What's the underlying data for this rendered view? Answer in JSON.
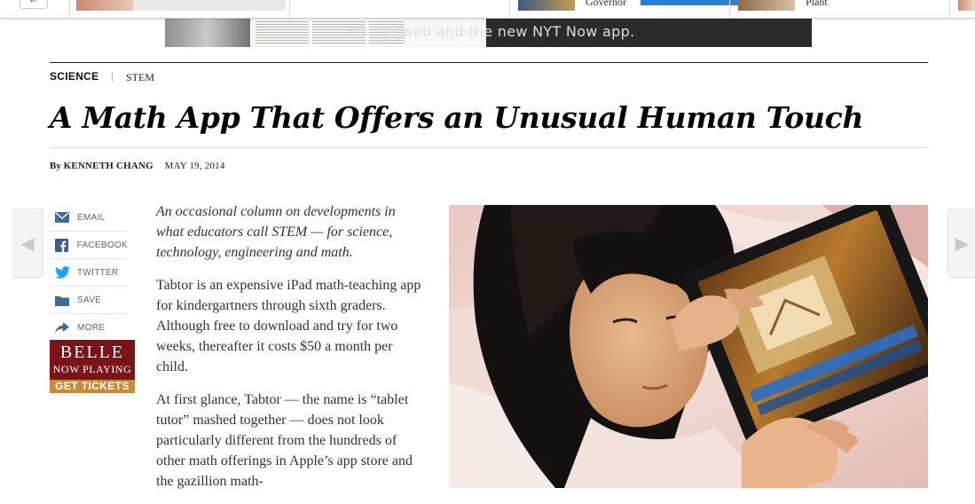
{
  "top_strip": {
    "back_label": "←",
    "items": [
      {
        "title": "Governor"
      },
      {
        "title": "Plant"
      }
    ]
  },
  "ad": {
    "message": "on the web and the new NYT Now app."
  },
  "kicker": {
    "section": "SCIENCE",
    "subsection": "STEM"
  },
  "headline": "A Math App That Offers an Unusual Human Touch",
  "byline": {
    "prefix": "By",
    "author": "KENNETH CHANG",
    "date": "MAY 19, 2014"
  },
  "nav": {
    "prev_arrow": "◀",
    "next_arrow": "▶"
  },
  "share": {
    "items": [
      {
        "label": "EMAIL",
        "icon": "email-icon"
      },
      {
        "label": "FACEBOOK",
        "icon": "facebook-icon"
      },
      {
        "label": "TWITTER",
        "icon": "twitter-icon"
      },
      {
        "label": "SAVE",
        "icon": "save-icon"
      },
      {
        "label": "MORE",
        "icon": "share-arrow-icon"
      }
    ]
  },
  "promo": {
    "title": "BELLE",
    "subtitle": "NOW PLAYING",
    "cta": "GET TICKETS"
  },
  "article": {
    "paragraphs": [
      "An occasional column on developments in what educators call STEM — for science, technology, engineering and math.",
      "Tabtor is an expensive iPad math-teaching app for kindergartners through sixth graders. Although free to download and try for two weeks, thereafter it costs $50 a month per child.",
      "At first glance, Tabtor — the name is “tablet tutor” mashed together — does not look particularly different from the hundreds of other math offerings in Apple’s app store and the gazillion math-"
    ]
  },
  "colors": {
    "promo_red": "#7a1418",
    "promo_gold": "#c88a3c",
    "facebook_blue": "#3b5998",
    "twitter_blue": "#1da1f2",
    "icon_blue": "#3f6c97"
  }
}
